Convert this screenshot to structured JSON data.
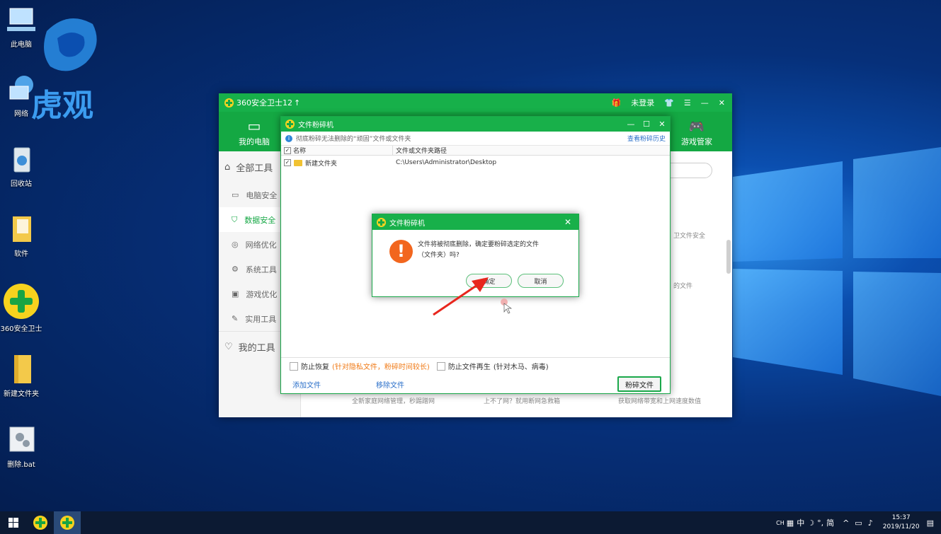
{
  "desktop": {
    "icons": [
      {
        "label": "此电脑"
      },
      {
        "label": "网络"
      },
      {
        "label": "回收站"
      },
      {
        "label": "软件"
      },
      {
        "label": "360安全卫士"
      },
      {
        "label": "新建文件夹"
      },
      {
        "label": "删除.bat"
      }
    ],
    "watermark": "虎观"
  },
  "main_window": {
    "title": "360安全卫士12",
    "login": "未登录",
    "nav": [
      {
        "label": "我的电脑"
      },
      {
        "label": "游戏管家"
      }
    ],
    "sidebar_head": "全部工具",
    "sidebar_items": [
      {
        "label": "电脑安全"
      },
      {
        "label": "数据安全"
      },
      {
        "label": "网络优化"
      },
      {
        "label": "系统工具"
      },
      {
        "label": "游戏优化"
      },
      {
        "label": "实用工具"
      }
    ],
    "sidebar_mine": "我的工具",
    "content_snippets": [
      "卫文件安全",
      "的文件",
      "全新家庭网络管理，秒踢蹭网",
      "上不了网？就用断网急救箱",
      "获取网络带宽和上网速度数值"
    ]
  },
  "shredder": {
    "title": "文件粉碎机",
    "info": "彻底粉碎无法删除的“顽固”文件或文件夹",
    "history_link": "查看粉碎历史",
    "col_name": "名称",
    "col_path": "文件或文件夹路径",
    "rows": [
      {
        "name": "新建文件夹",
        "path": "C:\\Users\\Administrator\\Desktop"
      }
    ],
    "opt1_label": "防止恢复",
    "opt1_note": "(针对隐私文件，粉碎时间较长)",
    "opt2_label": "防止文件再生",
    "opt2_note": "(针对木马、病毒)",
    "add_file": "添加文件",
    "remove_file": "移除文件",
    "shred_button": "粉碎文件"
  },
  "confirm": {
    "title": "文件粉碎机",
    "message_line1": "文件将被彻底删除，确定要粉碎选定的文件",
    "message_line2": "（文件夹）吗?",
    "ok": "确定",
    "cancel": "取消"
  },
  "taskbar": {
    "tray_lang": "CH",
    "ime_1": "中",
    "ime_2": "简",
    "time": "15:37",
    "date": "2019/11/20"
  }
}
